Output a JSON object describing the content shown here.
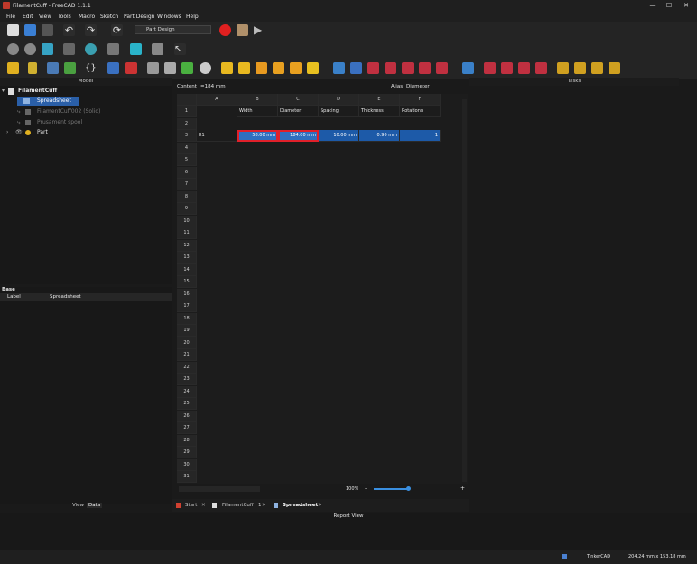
{
  "window": {
    "title": "FilamentCuff - FreeCAD 1.1.1",
    "min": "—",
    "max": "☐",
    "close": "✕"
  },
  "menu": [
    "File",
    "Edit",
    "View",
    "Tools",
    "Macro",
    "Sketch",
    "Part Design",
    "Windows",
    "Help"
  ],
  "workbench": "Part Design",
  "panels": {
    "model": "Model",
    "tasks": "Tasks",
    "report": "Report View"
  },
  "tree": {
    "root": "FilamentCuff",
    "items": [
      {
        "label": "Spreadsheet",
        "selected": true
      },
      {
        "label": "FilamentCuff002 (Solid)",
        "dim": true
      },
      {
        "label": "Prusament spool",
        "dim": true
      },
      {
        "label": "Part",
        "dim": false
      }
    ]
  },
  "properties": {
    "group": "Base",
    "col1": "Label",
    "col2": "Spreadsheet",
    "tab_view": "View",
    "tab_data": "Data"
  },
  "sheet": {
    "content_label": "Content",
    "content_value": "=184 mm",
    "alias_label": "Alias",
    "alias_value": "Diameter",
    "columns": [
      "A",
      "B",
      "C",
      "D",
      "E",
      "F"
    ],
    "row1": [
      "",
      "Width",
      "Diameter",
      "Spacing",
      "Thickness",
      "Rotations"
    ],
    "row3": [
      "R1",
      "58.00 mm",
      "184.00 mm",
      "10.00 mm",
      "0.90 mm",
      "1"
    ],
    "row_count": 31,
    "zoom": "100%",
    "zoom_minus": "-",
    "zoom_plus": "+"
  },
  "tabs": [
    "Start",
    "FilamentCuff : 1",
    "Spreadsheet"
  ],
  "status": {
    "nav": "TinkerCAD",
    "dims": "204.24 mm x 153.18 mm"
  }
}
